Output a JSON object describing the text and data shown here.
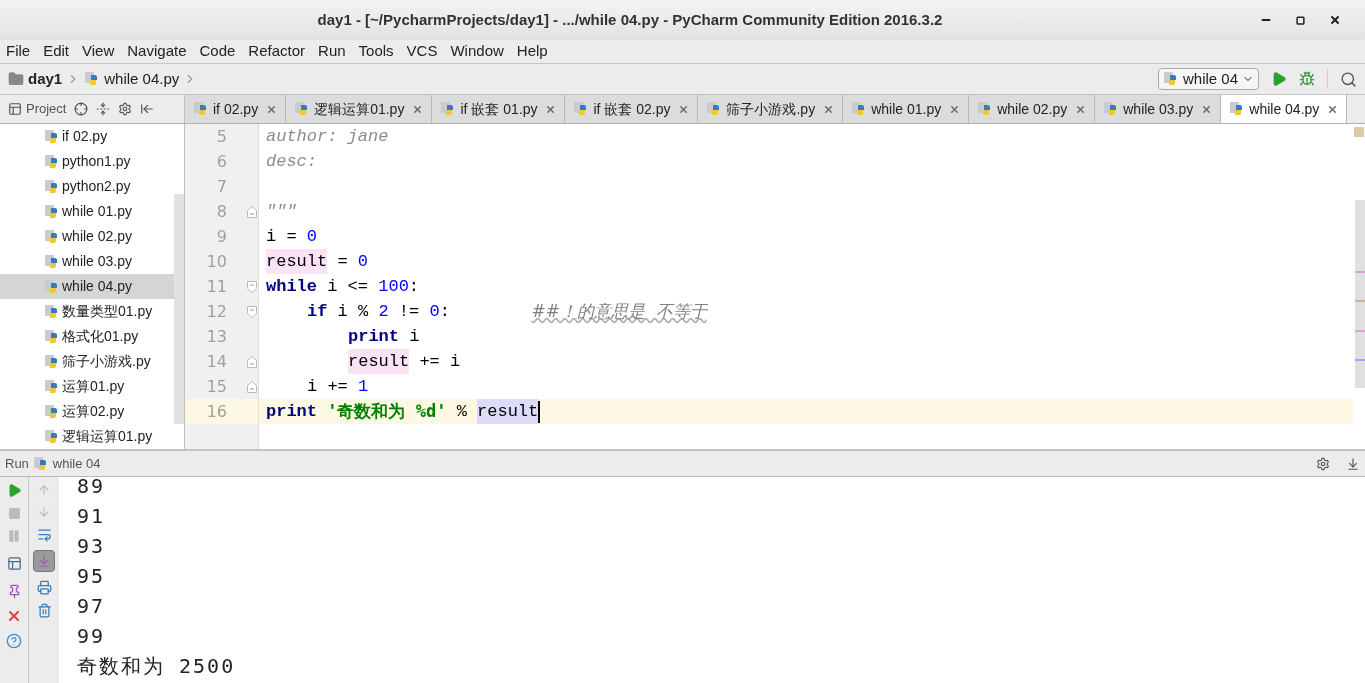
{
  "window": {
    "title": "day1 - [~/PycharmProjects/day1] - .../while 04.py - PyCharm Community Edition 2016.3.2"
  },
  "menu": [
    "File",
    "Edit",
    "View",
    "Navigate",
    "Code",
    "Refactor",
    "Run",
    "Tools",
    "VCS",
    "Window",
    "Help"
  ],
  "breadcrumbs": [
    {
      "label": "day1",
      "kind": "folder"
    },
    {
      "label": "while 04.py",
      "kind": "file"
    }
  ],
  "run_config": {
    "label": "while 04"
  },
  "project_panel": {
    "title": "Project",
    "items": [
      {
        "label": "if 02.py",
        "selected": false
      },
      {
        "label": "python1.py",
        "selected": false
      },
      {
        "label": "python2.py",
        "selected": false
      },
      {
        "label": "while 01.py",
        "selected": false
      },
      {
        "label": "while 02.py",
        "selected": false
      },
      {
        "label": "while 03.py",
        "selected": false
      },
      {
        "label": "while 04.py",
        "selected": true
      },
      {
        "label": "数量类型01.py",
        "selected": false
      },
      {
        "label": "格式化01.py",
        "selected": false
      },
      {
        "label": "筛子小游戏.py",
        "selected": false
      },
      {
        "label": "运算01.py",
        "selected": false
      },
      {
        "label": "运算02.py",
        "selected": false
      },
      {
        "label": "逻辑运算01.py",
        "selected": false
      }
    ]
  },
  "tabs": [
    {
      "label": "if 02.py",
      "selected": false
    },
    {
      "label": "逻辑运算01.py",
      "selected": false
    },
    {
      "label": "if 嵌套 01.py",
      "selected": false
    },
    {
      "label": "if 嵌套 02.py",
      "selected": false
    },
    {
      "label": "筛子小游戏.py",
      "selected": false
    },
    {
      "label": "while 01.py",
      "selected": false
    },
    {
      "label": "while 02.py",
      "selected": false
    },
    {
      "label": "while 03.py",
      "selected": false
    },
    {
      "label": "while 04.py",
      "selected": true
    }
  ],
  "code": {
    "lines": [
      {
        "number": "5",
        "current": false,
        "tokens": [
          {
            "text": "author: jane",
            "kind": "docstring"
          }
        ]
      },
      {
        "number": "6",
        "current": false,
        "tokens": [
          {
            "text": "desc:",
            "kind": "docstring"
          }
        ]
      },
      {
        "number": "7",
        "current": false
      },
      {
        "number": "8",
        "current": false,
        "fold_close": true,
        "tokens": [
          {
            "text": "\"\"\"",
            "kind": "docstring"
          }
        ]
      },
      {
        "number": "9",
        "current": false,
        "tokens": [
          {
            "text": "i = ",
            "kind": "plain"
          },
          {
            "text": "0",
            "kind": "number"
          }
        ]
      },
      {
        "number": "10",
        "current": false,
        "tokens": [
          {
            "text": "result",
            "kind": "highlight"
          },
          {
            "text": " = ",
            "kind": "plain"
          },
          {
            "text": "0",
            "kind": "number"
          }
        ]
      },
      {
        "number": "11",
        "current": false,
        "fold_open": true,
        "tokens": [
          {
            "text": "while",
            "kind": "keyword"
          },
          {
            "text": " i <= ",
            "kind": "plain"
          },
          {
            "text": "100",
            "kind": "number"
          },
          {
            "text": ":",
            "kind": "plain"
          }
        ],
        "children": [
          {
            "number": "12",
            "current": false,
            "fold_open": true,
            "tokens": [
              {
                "text": "if",
                "kind": "keyword"
              },
              {
                "text": " i % ",
                "kind": "plain"
              },
              {
                "text": "2",
                "kind": "number"
              },
              {
                "text": " != ",
                "kind": "plain"
              },
              {
                "text": "0",
                "kind": "number"
              },
              {
                "text": ":        ",
                "kind": "plain"
              },
              {
                "text": "##！的意思是  不等于",
                "kind": "spell_comment"
              }
            ],
            "children": [
              {
                "number": "13",
                "current": false,
                "tokens": [
                  {
                    "text": "print",
                    "kind": "keyword"
                  },
                  {
                    "text": " i",
                    "kind": "plain"
                  }
                ]
              },
              {
                "number": "14",
                "current": false,
                "fold_close": true,
                "tokens": [
                  {
                    "text": "result",
                    "kind": "highlight"
                  },
                  {
                    "text": " += i",
                    "kind": "plain"
                  }
                ]
              }
            ]
          },
          {
            "number": "15",
            "current": false,
            "fold_close": true,
            "tokens": [
              {
                "text": "i += ",
                "kind": "plain"
              },
              {
                "text": "1",
                "kind": "number"
              }
            ]
          }
        ]
      },
      {
        "number": "16",
        "current": true,
        "tokens": [
          {
            "text": "print",
            "kind": "keyword"
          },
          {
            "text": " '奇数和为 %d'",
            "kind": "string"
          },
          {
            "text": " % ",
            "kind": "plain"
          },
          {
            "text": "result",
            "kind": "selected"
          }
        ]
      }
    ]
  },
  "run_panel": {
    "label": "Run",
    "config": "while 04",
    "scroll_to_end_on": true,
    "output": [
      "89",
      "91",
      "93",
      "95",
      "97",
      "99",
      "奇数和为 2500"
    ]
  }
}
